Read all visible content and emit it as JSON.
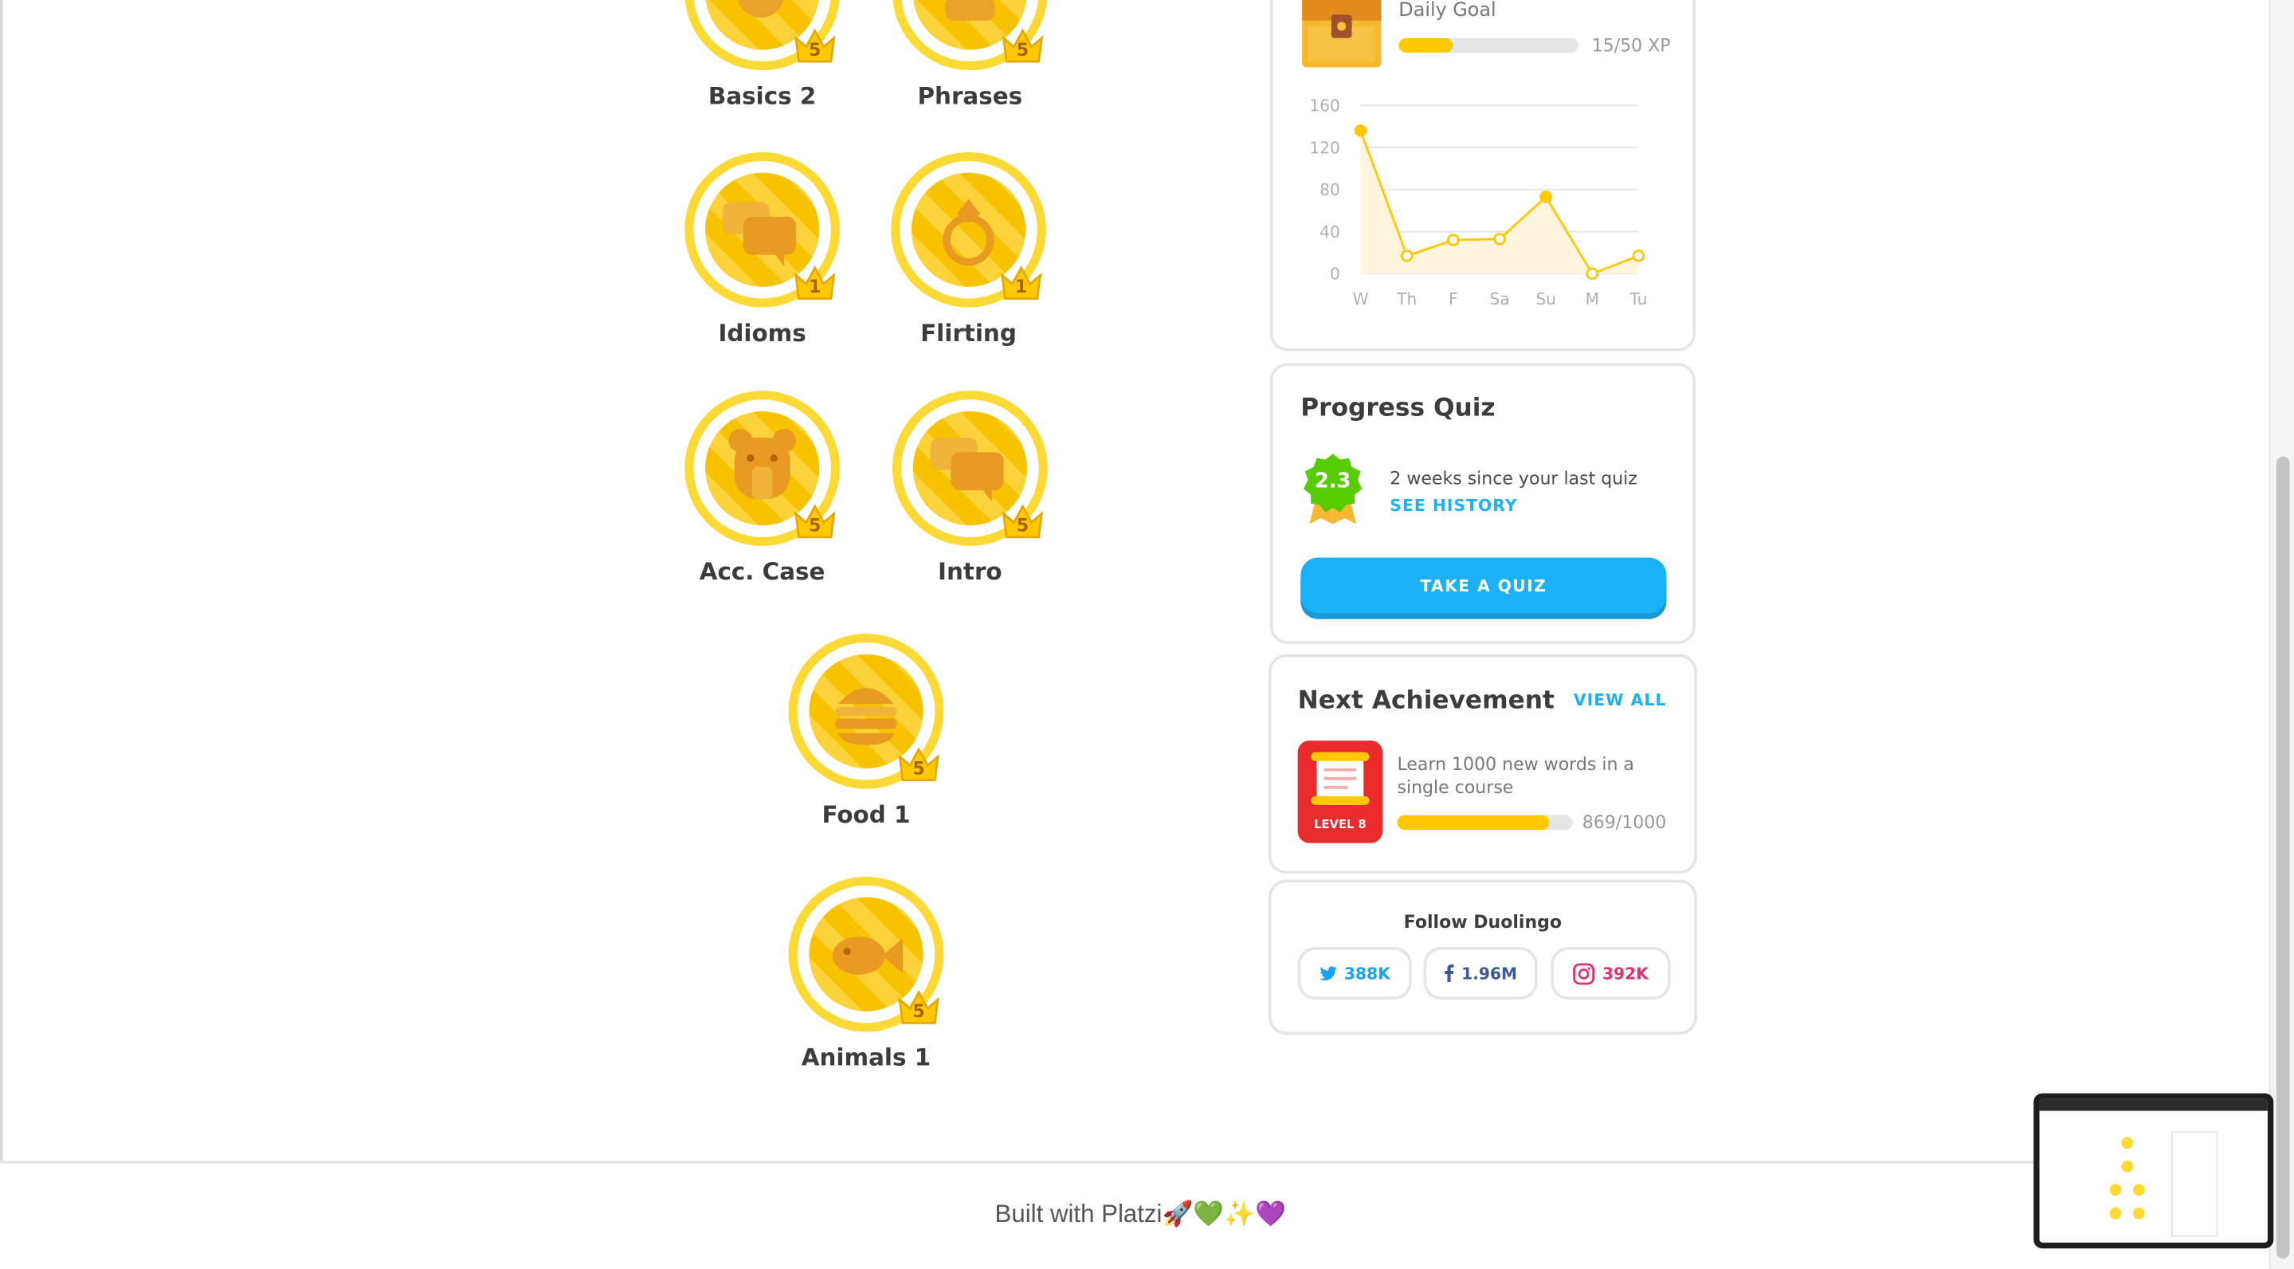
{
  "skills": [
    {
      "label": "Basics 2",
      "crown": "5",
      "icon": "chat-icon"
    },
    {
      "label": "Phrases",
      "crown": "5",
      "icon": "chat-icon"
    },
    {
      "label": "Idioms",
      "crown": "1",
      "icon": "chat-bubbles-icon"
    },
    {
      "label": "Flirting",
      "crown": "1",
      "icon": "ring-icon"
    },
    {
      "label": "Acc. Case",
      "crown": "5",
      "icon": "bear-icon"
    },
    {
      "label": "Intro",
      "crown": "5",
      "icon": "chat-bubbles-icon"
    },
    {
      "label": "Food 1",
      "crown": "5",
      "icon": "burger-icon"
    },
    {
      "label": "Animals 1",
      "crown": "5",
      "icon": "fish-icon"
    }
  ],
  "daily_goal": {
    "title": "Daily Goal",
    "xp": "15/50 XP",
    "progress": 0.3,
    "icon": "treasure-chest-icon"
  },
  "chart_data": {
    "type": "line",
    "categories": [
      "W",
      "Th",
      "F",
      "Sa",
      "Su",
      "M",
      "Tu"
    ],
    "values": [
      136,
      17,
      32,
      33,
      73,
      0,
      17
    ],
    "yticks": [
      "160",
      "120",
      "80",
      "40",
      "0"
    ],
    "ylim": [
      0,
      160
    ],
    "color": "#ffc800",
    "grid": true
  },
  "progress_quiz": {
    "title": "Progress Quiz",
    "score": "2.3",
    "message": "2 weeks since your last quiz",
    "history_link": "SEE HISTORY",
    "button": "TAKE A QUIZ"
  },
  "next_achievement": {
    "title": "Next Achievement",
    "view_all": "VIEW ALL",
    "level": "LEVEL 8",
    "description": "Learn 1000 new words in a single course",
    "count": "869/1000",
    "progress": 0.869
  },
  "follow": {
    "title": "Follow Duolingo",
    "twitter": "388K",
    "facebook": "1.96M",
    "instagram": "392K"
  },
  "footer": {
    "text": "Built with Platzi🚀💚✨💜"
  },
  "colors": {
    "gold": "#ffc800",
    "blue": "#1cb0f6",
    "green": "#58cc02",
    "red": "#ea2b2b"
  }
}
